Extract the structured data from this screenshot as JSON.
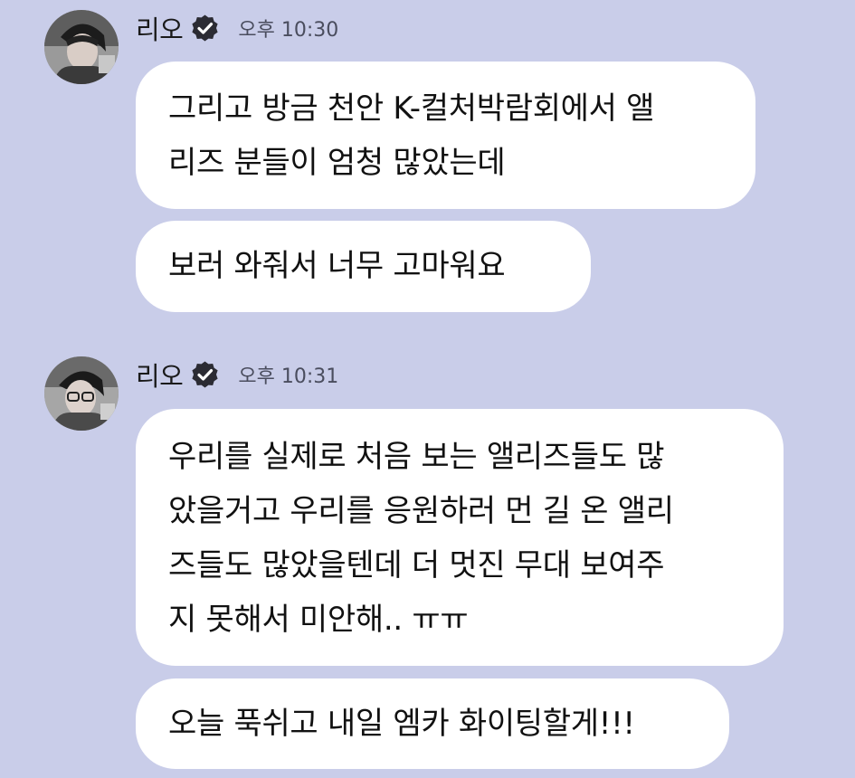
{
  "colors": {
    "background": "#c9cde9",
    "bubble": "#ffffff",
    "verified_badge": "#2b2b33"
  },
  "messages": [
    {
      "sender": "리오",
      "verified_icon": "verified-badge-icon",
      "time": "오후 10:30",
      "bubbles": [
        {
          "lines": [
            "그리고 방금 천안 K-컬처박람회에서 앨",
            "리즈 분들이 엄청 많았는데"
          ]
        },
        {
          "lines": [
            "보러 와줘서 너무 고마워요"
          ]
        }
      ]
    },
    {
      "sender": "리오",
      "verified_icon": "verified-badge-icon",
      "time": "오후 10:31",
      "bubbles": [
        {
          "lines": [
            "우리를 실제로 처음 보는 앨리즈들도 많",
            "았을거고 우리를 응원하러 먼 길 온 앨리",
            "즈들도 많았을텐데 더 멋진 무대 보여주",
            "지 못해서 미안해.. ㅠㅠ"
          ]
        },
        {
          "lines": [
            "오늘 푹쉬고 내일 엠카 화이팅할게!!!"
          ]
        }
      ]
    }
  ]
}
